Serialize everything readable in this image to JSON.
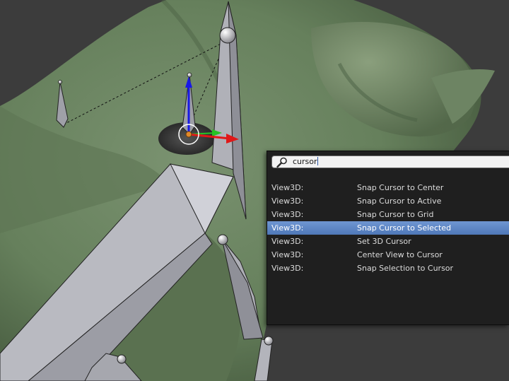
{
  "search": {
    "value": "cursor",
    "icon": "search-icon"
  },
  "results": [
    {
      "context": "View3D:",
      "operator": "Snap Cursor to Center",
      "active": false
    },
    {
      "context": "View3D:",
      "operator": "Snap Cursor to Active",
      "active": false
    },
    {
      "context": "View3D:",
      "operator": "Snap Cursor to Grid",
      "active": false
    },
    {
      "context": "View3D:",
      "operator": "Snap Cursor to Selected",
      "active": true
    },
    {
      "context": "View3D:",
      "operator": "Set 3D Cursor",
      "active": false
    },
    {
      "context": "View3D:",
      "operator": "Center View to Cursor",
      "active": false
    },
    {
      "context": "View3D:",
      "operator": "Snap Selection to Cursor",
      "active": false
    }
  ],
  "colors": {
    "viewport_background": "#3a3a3a",
    "mesh_green": "#6b8160",
    "bone_grey": "#b3b3ba",
    "popup_background": "#1f1f1f",
    "highlight": "#5a83c4",
    "gizmo_x": "#e01818",
    "gizmo_y": "#25c425",
    "gizmo_z": "#1818e6"
  }
}
